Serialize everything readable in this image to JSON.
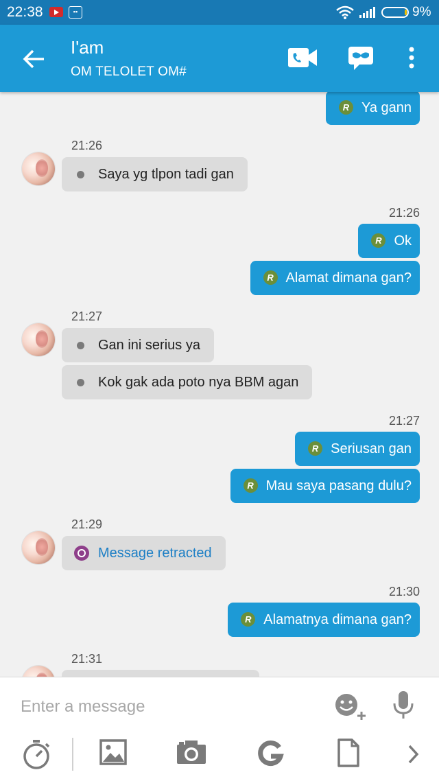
{
  "status_bar": {
    "time": "22:38",
    "battery": "9%"
  },
  "header": {
    "title": "I'am",
    "subtitle": "OM TELOLET OM#",
    "icons": [
      "back-arrow-icon",
      "video-call-icon",
      "mask-icon",
      "more-vert-icon"
    ]
  },
  "messages": {
    "m1": "Ya gann",
    "ts1": "21:26",
    "m2": "Saya yg tlpon tadi gan",
    "ts2": "21:26",
    "m3": "Ok",
    "m4": "Alamat dimana gan?",
    "ts3": "21:27",
    "m5": "Gan ini serius ya",
    "m6": "Kok gak ada poto nya BBM agan",
    "ts4": "21:27",
    "m7": "Seriusan gan",
    "m8": "Mau saya pasang dulu?",
    "ts5": "21:29",
    "m9": "Message retracted",
    "ts6": "21:30",
    "m10": "Alamatnya dimana gan?",
    "ts7": "21:31",
    "read_badge": "R"
  },
  "composer": {
    "placeholder": "Enter a message",
    "toolbar_icons": [
      "timer-icon",
      "image-icon",
      "camera-icon",
      "google-icon",
      "file-icon",
      "chevron-right-icon"
    ]
  },
  "colors": {
    "status_bar": "#1879b4",
    "app_bar": "#1d9ad6",
    "outgoing_bubble": "#1d9ad6",
    "incoming_bubble": "#dcdcdc",
    "read_badge": "#6b8f3a"
  }
}
